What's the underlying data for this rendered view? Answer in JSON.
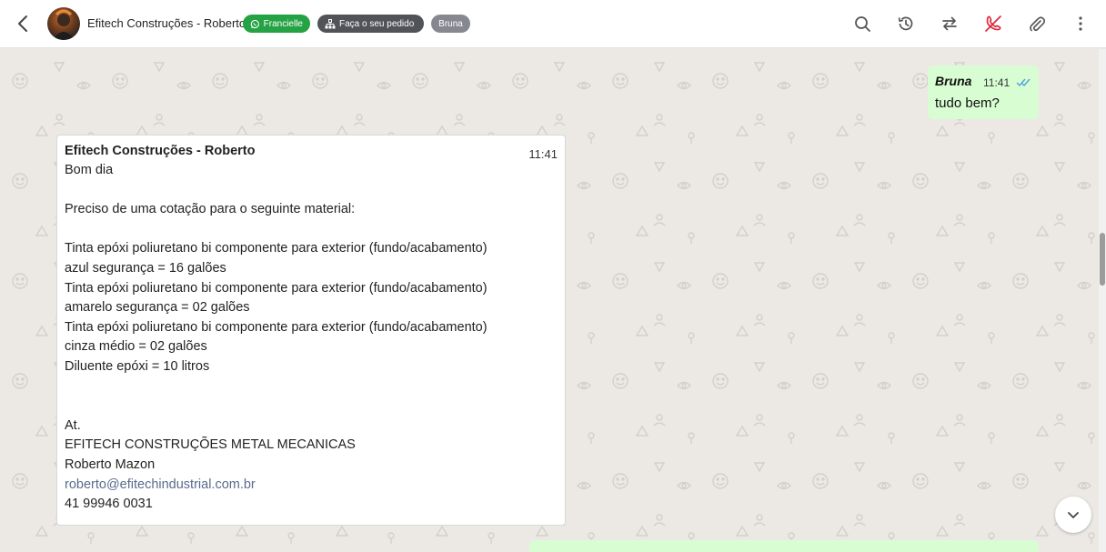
{
  "header": {
    "title": "Efitech Construções - Roberto",
    "tags": [
      {
        "label": "Francielle",
        "icon": "whatsapp-icon",
        "color": "#25a244"
      },
      {
        "label": "Faça o seu pedido",
        "icon": "org-chart-icon",
        "color": "#505358"
      },
      {
        "label": "Bruna",
        "color": "#85898f"
      }
    ],
    "tools": [
      "search-icon",
      "history-icon",
      "transfer-icon",
      "end-call-icon",
      "attach-icon",
      "more-icon"
    ]
  },
  "messages": {
    "outgoing": {
      "sender": "Bruna",
      "time": "11:41",
      "text": "tudo bem?",
      "status": "read"
    },
    "incoming": {
      "sender": "Efitech Construções - Roberto",
      "time": "11:41",
      "lines": [
        "Bom dia",
        "",
        "Preciso de uma cotação para o seguinte material:",
        "",
        "Tinta epóxi poliuretano bi componente para exterior (fundo/acabamento)",
        "azul segurança = 16 galões",
        "Tinta epóxi poliuretano bi componente para exterior (fundo/acabamento)",
        "amarelo segurança = 02 galões",
        "Tinta epóxi poliuretano bi componente para exterior (fundo/acabamento)",
        "cinza médio = 02 galões",
        "Diluente epóxi = 10 litros",
        "",
        "",
        "At.",
        "EFITECH CONSTRUÇÕES METAL MECANICAS",
        "Roberto Mazon",
        "roberto@efitechindustrial.com.br",
        "41 99946 0031"
      ]
    }
  },
  "colors": {
    "outgoing_bubble": "#d9fdd3",
    "incoming_bubble": "#ffffff",
    "chat_background": "#ece9e4",
    "read_ticks": "#4fa3e0",
    "end_call": "#e0253a"
  }
}
